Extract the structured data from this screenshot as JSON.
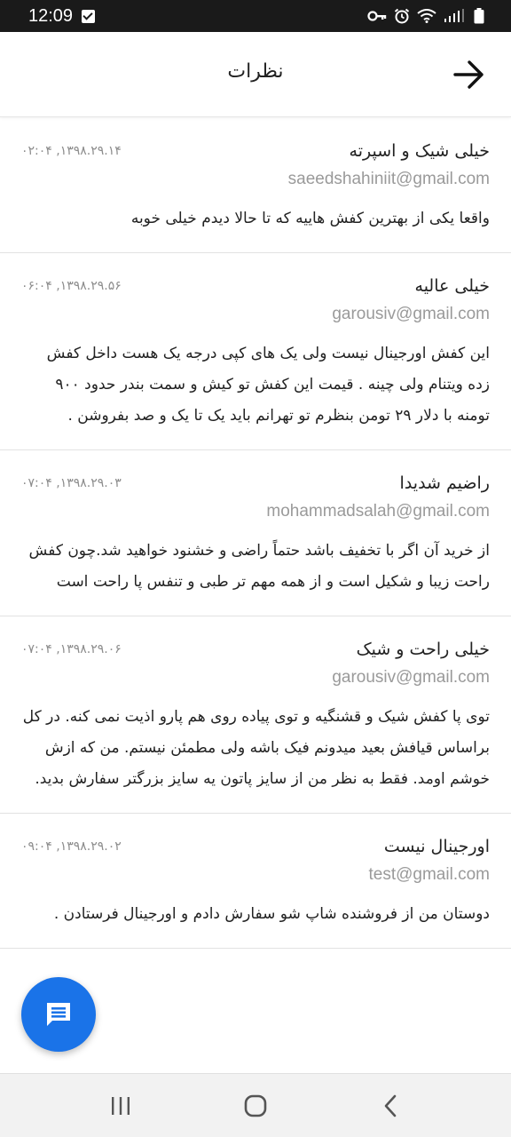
{
  "status_bar": {
    "time": "12:09"
  },
  "header": {
    "title": "نظرات"
  },
  "comments": [
    {
      "title": "خیلی شیک و اسپرته",
      "date": "۰۲:۰۴ ,۱۳۹۸.۲۹.۱۴",
      "email": "saeedshahiniit@gmail.com",
      "body": "واقعا یکی از بهترین کفش هاییه که تا حالا دیدم خیلی خوبه"
    },
    {
      "title": "خیلی عالیه",
      "date": "۰۶:۰۴ ,۱۳۹۸.۲۹.۵۶",
      "email": "garousiv@gmail.com",
      "body": "این کفش اورجینال نیست ولی یک های کپی درجه یک هست داخل کفش زده ویتنام ولی چینه . قیمت این کفش تو کیش و سمت بندر حدود ۹۰۰ تومنه با دلار ۲۹ تومن بنظرم تو تهرانم باید یک تا یک و صد بفروشن ."
    },
    {
      "title": "راضیم شدیدا",
      "date": "۰۷:۰۴ ,۱۳۹۸.۲۹.۰۳",
      "email": "mohammadsalah@gmail.com",
      "body": "از خرید آن اگر با تخفیف باشد حتماً راضی و خشنود خواهید شد.چون کفش راحت زیبا و شکیل است و از همه مهم تر طبی و تنفس پا راحت است"
    },
    {
      "title": "خیلی راحت و شیک",
      "date": "۰۷:۰۴ ,۱۳۹۸.۲۹.۰۶",
      "email": "garousiv@gmail.com",
      "body": "توی پا کفش شیک و قشنگیه و توی پیاده روی هم پارو اذیت نمی کنه. در کل براساس قیافش بعید میدونم فیک باشه ولی مطمئن نیستم. من که ازش خوشم اومد. فقط به نظر من از سایز پاتون یه سایز بزرگتر سفارش بدید."
    },
    {
      "title": "اورجینال نیست",
      "date": "۰۹:۰۴ ,۱۳۹۸.۲۹.۰۲",
      "email": "test@gmail.com",
      "body": "دوستان من از فروشنده شاپ شو سفارش دادم و اورجینال فرستادن ."
    }
  ],
  "colors": {
    "fab": "#1a73e8",
    "status_bar": "#1a1a1a"
  },
  "icons": {
    "fab": "message-icon",
    "back": "arrow-right-icon"
  }
}
